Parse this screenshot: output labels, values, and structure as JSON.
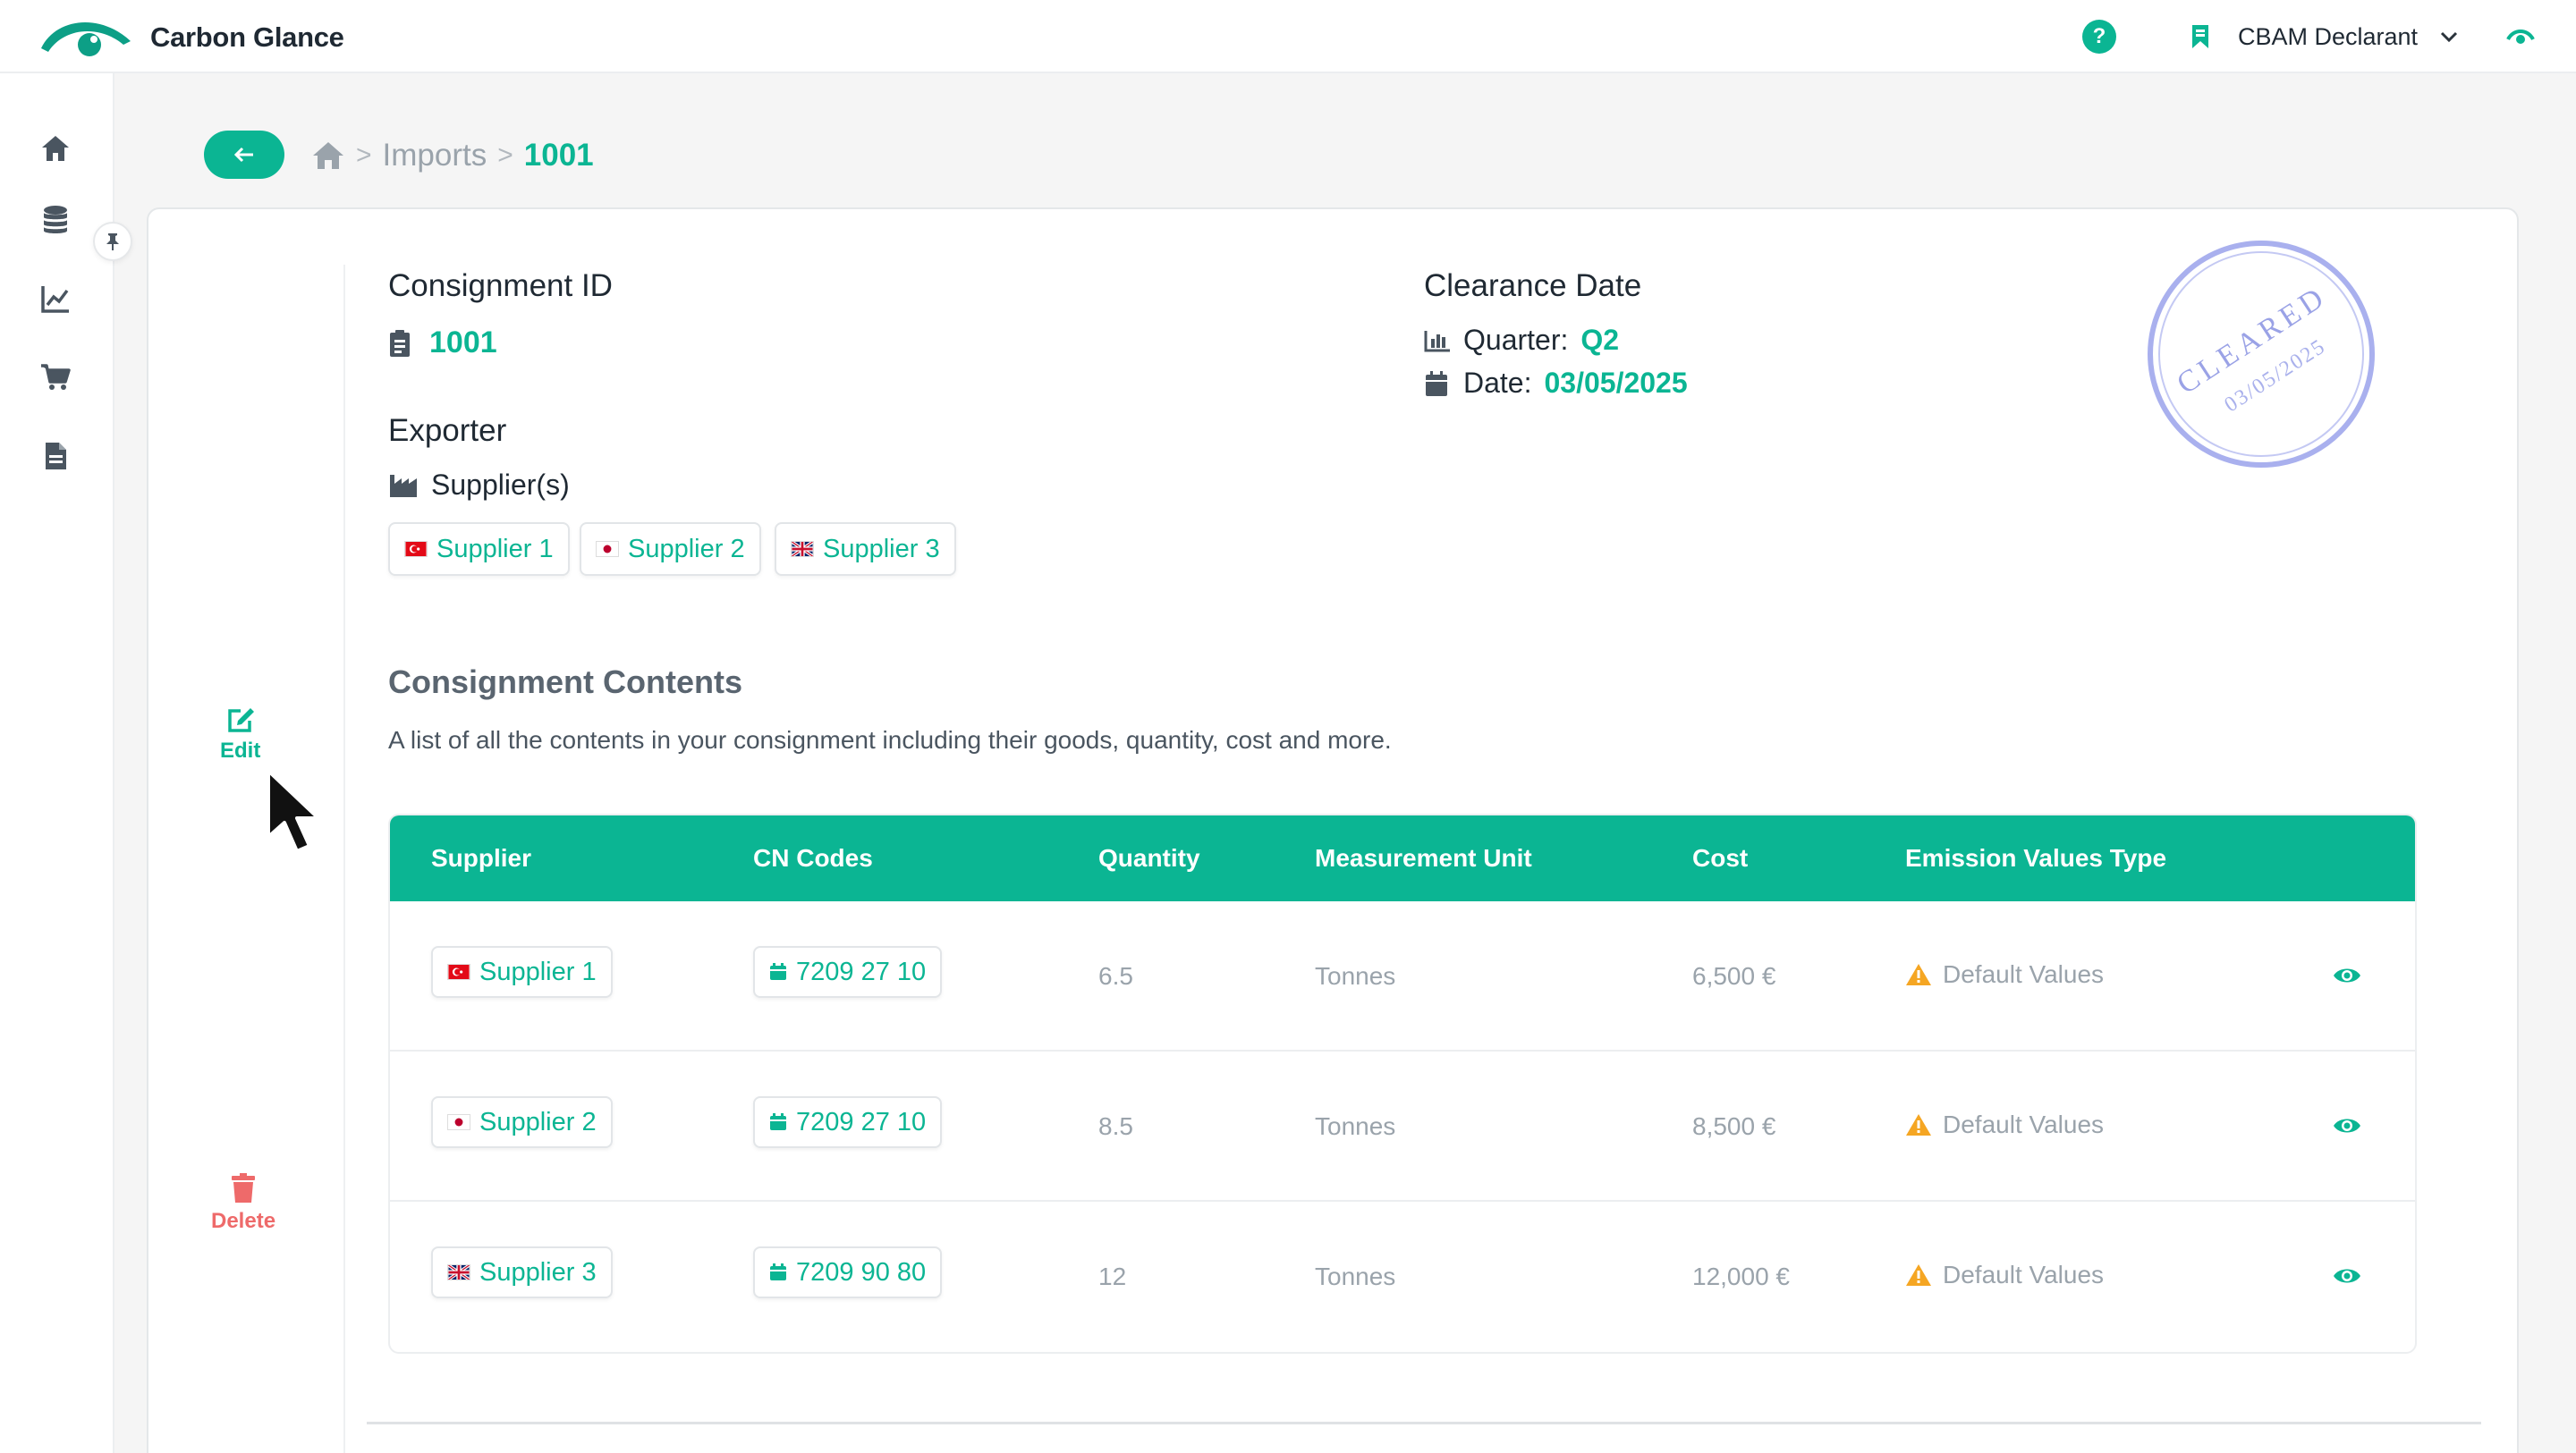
{
  "app": {
    "brand": "Carbon Glance",
    "help_glyph": "?",
    "role": "CBAM Declarant",
    "icons": {
      "logo": "eye-arc-logo",
      "role": "bookmark-icon",
      "role_chevron": "chevron-down-icon",
      "top_right": "eye-icon"
    }
  },
  "sidebar": {
    "items": [
      {
        "name": "home",
        "icon": "home-icon"
      },
      {
        "name": "database",
        "icon": "database-icon"
      },
      {
        "name": "analytics",
        "icon": "line-chart-icon"
      },
      {
        "name": "cart",
        "icon": "cart-icon"
      },
      {
        "name": "documents",
        "icon": "document-icon"
      }
    ],
    "pin_icon": "pin-icon"
  },
  "breadcrumb": {
    "back_icon": "arrow-left-icon",
    "home_icon": "home-icon",
    "sep": ">",
    "imports": "Imports",
    "current": "1001"
  },
  "actions": {
    "edit": "Edit",
    "delete": "Delete"
  },
  "consignment": {
    "id_label": "Consignment ID",
    "id": "1001",
    "exporter_label": "Exporter",
    "suppliers_label": "Supplier(s)",
    "suppliers": [
      "Supplier 1",
      "Supplier 2",
      "Supplier 3"
    ],
    "clearance_label": "Clearance Date",
    "quarter_label": "Quarter:",
    "quarter": "Q2",
    "date_label": "Date:",
    "date": "03/05/2025"
  },
  "stamp": {
    "text": "CLEARED",
    "date": "03/05/2025",
    "color": "#8f98e0"
  },
  "contents": {
    "title": "Consignment Contents",
    "subtitle": "A list of all the contents in your consignment including their goods, quantity, cost and more.",
    "columns": [
      "Supplier",
      "CN Codes",
      "Quantity",
      "Measurement Unit",
      "Cost",
      "Emission Values Type"
    ],
    "rows": [
      {
        "supplier": "Supplier 1",
        "cn_code": "7209 27 10",
        "quantity": "6.5",
        "unit": "Tonnes",
        "cost": "6,500 €",
        "emission": "Default Values"
      },
      {
        "supplier": "Supplier 2",
        "cn_code": "7209 27 10",
        "quantity": "8.5",
        "unit": "Tonnes",
        "cost": "8,500 €",
        "emission": "Default Values"
      },
      {
        "supplier": "Supplier 3",
        "cn_code": "7209 90 80",
        "quantity": "12",
        "unit": "Tonnes",
        "cost": "12,000 €",
        "emission": "Default Values"
      }
    ]
  },
  "colors": {
    "accent": "#0bb593",
    "danger": "#ee6a6a",
    "warning": "#f5a623"
  }
}
